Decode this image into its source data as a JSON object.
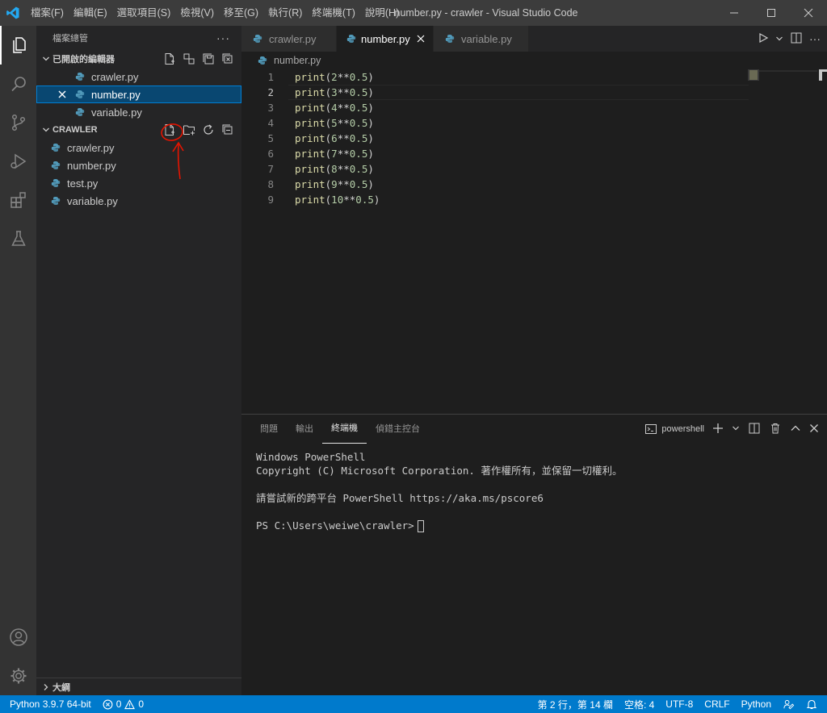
{
  "window": {
    "title": "number.py - crawler - Visual Studio Code",
    "menu": [
      "檔案(F)",
      "編輯(E)",
      "選取項目(S)",
      "檢視(V)",
      "移至(G)",
      "執行(R)",
      "終端機(T)",
      "說明(H)"
    ]
  },
  "sidebar": {
    "title": "檔案總管",
    "open_editors_label": "已開啟的編輯器",
    "open_editors": [
      {
        "name": "crawler.py"
      },
      {
        "name": "number.py"
      },
      {
        "name": "variable.py"
      }
    ],
    "folder_label": "CRAWLER",
    "files": [
      {
        "name": "crawler.py"
      },
      {
        "name": "number.py"
      },
      {
        "name": "test.py"
      },
      {
        "name": "variable.py"
      }
    ],
    "outline_label": "大綱"
  },
  "editor": {
    "tabs": [
      {
        "label": "crawler.py"
      },
      {
        "label": "number.py"
      },
      {
        "label": "variable.py"
      }
    ],
    "breadcrumb": "number.py",
    "lines": [
      {
        "n": "1",
        "code": "print(2**0.5)"
      },
      {
        "n": "2",
        "code": "print(3**0.5)"
      },
      {
        "n": "3",
        "code": "print(4**0.5)"
      },
      {
        "n": "4",
        "code": "print(5**0.5)"
      },
      {
        "n": "5",
        "code": "print(6**0.5)"
      },
      {
        "n": "6",
        "code": "print(7**0.5)"
      },
      {
        "n": "7",
        "code": "print(8**0.5)"
      },
      {
        "n": "8",
        "code": "print(9**0.5)"
      },
      {
        "n": "9",
        "code": "print(10**0.5)"
      }
    ]
  },
  "panel": {
    "tabs": [
      "問題",
      "輸出",
      "終端機",
      "偵錯主控台"
    ],
    "shell_label": "powershell",
    "terminal_lines": [
      "Windows PowerShell",
      "Copyright (C) Microsoft Corporation. 著作權所有，並保留一切權利。",
      "",
      "請嘗試新的跨平台 PowerShell https://aka.ms/pscore6",
      "",
      "PS C:\\Users\\weiwe\\crawler>"
    ]
  },
  "statusbar": {
    "interpreter": "Python 3.9.7 64-bit",
    "errors": "0",
    "warnings": "0",
    "position": "第 2 行，第 14 欄",
    "indent": "空格: 4",
    "encoding": "UTF-8",
    "eol": "CRLF",
    "language": "Python"
  },
  "colors": {
    "accent": "#007acc",
    "annotation_red": "#e51400"
  }
}
